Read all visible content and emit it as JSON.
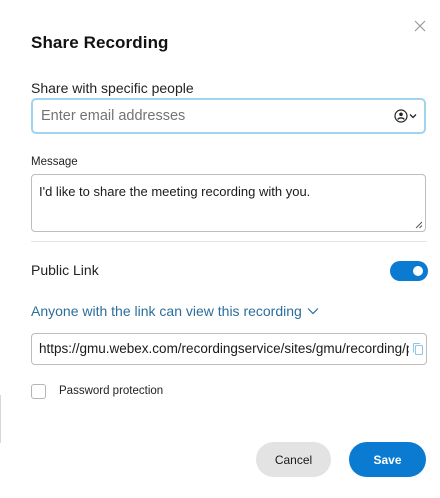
{
  "dialog": {
    "title": "Share Recording",
    "close_icon": "close-icon"
  },
  "share": {
    "label": "Share with specific people",
    "email_placeholder": "Enter email addresses",
    "email_value": "",
    "people_icon": "people-picker-icon"
  },
  "message": {
    "label": "Message",
    "text": "I'd like to share the meeting recording with you."
  },
  "public_link": {
    "label": "Public Link",
    "enabled": true,
    "access_text": "Anyone with the link can view this recording",
    "url": "https://gmu.webex.com/recordingservice/sites/gmu/recording/playback",
    "copy_icon": "copy-icon"
  },
  "password": {
    "label": "Password protection",
    "checked": false
  },
  "buttons": {
    "cancel_label": "Cancel",
    "save_label": "Save"
  },
  "colors": {
    "accent": "#0a7bd1",
    "link": "#2b6d9c",
    "focus_border": "#9fd3f0"
  }
}
